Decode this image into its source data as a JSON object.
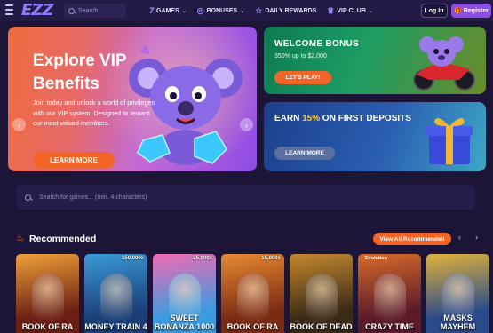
{
  "header": {
    "logo": "EZZ",
    "search_placeholder": "Search",
    "nav": [
      {
        "label": "GAMES",
        "icon": "seven-icon"
      },
      {
        "label": "BONUSES",
        "icon": "coin-icon"
      },
      {
        "label": "DAILY REWARDS",
        "icon": "star-icon"
      },
      {
        "label": "VIP CLUB",
        "icon": "crown-icon"
      }
    ],
    "login": "Log In",
    "register": "Register"
  },
  "hero": {
    "title": "Explore VIP Benefits",
    "text": "Join today and unlock a world of privileges with our VIP system. Designed to reward our most valued members.",
    "cta": "LEARN MORE"
  },
  "welcome": {
    "title": "WELCOME BONUS",
    "subtitle": "350% up to $2,000",
    "cta": "LET'S PLAY!"
  },
  "deposit": {
    "title_prefix": "EARN ",
    "title_pct": "15%",
    "title_suffix": " ON FIRST DEPOSITS",
    "cta": "LEARN MORE"
  },
  "game_search": {
    "placeholder": "Search for games... (min. 4 characters)"
  },
  "recommended": {
    "title": "Recommended",
    "view_all": "View All Recommended",
    "prev": "‹",
    "next": "›",
    "games": [
      {
        "name": "BOOK OF RA",
        "count": "",
        "bg": "#6a1f12",
        "accent": "#f0a03a"
      },
      {
        "name": "MONEY TRAIN 4",
        "count": "150,000x",
        "bg": "#1a3f78",
        "accent": "#3a9ad8"
      },
      {
        "name": "SWEET BONANZA 1000",
        "count": "25,000x",
        "bg": "#3a9ce0",
        "accent": "#f06ab4"
      },
      {
        "name": "BOOK OF RA",
        "count": "15,000x",
        "bg": "#7a2a12",
        "accent": "#e88a32"
      },
      {
        "name": "BOOK OF DEAD",
        "count": "",
        "bg": "#3a2a18",
        "accent": "#c4882f"
      },
      {
        "name": "CRAZY TIME",
        "count": "",
        "tag": "Evolution",
        "bg": "#5a1a2a",
        "accent": "#d86a2a"
      },
      {
        "name": "MASKS MAYHEM",
        "count": "",
        "bg": "#2a4a8a",
        "accent": "#e0b23a"
      }
    ]
  }
}
